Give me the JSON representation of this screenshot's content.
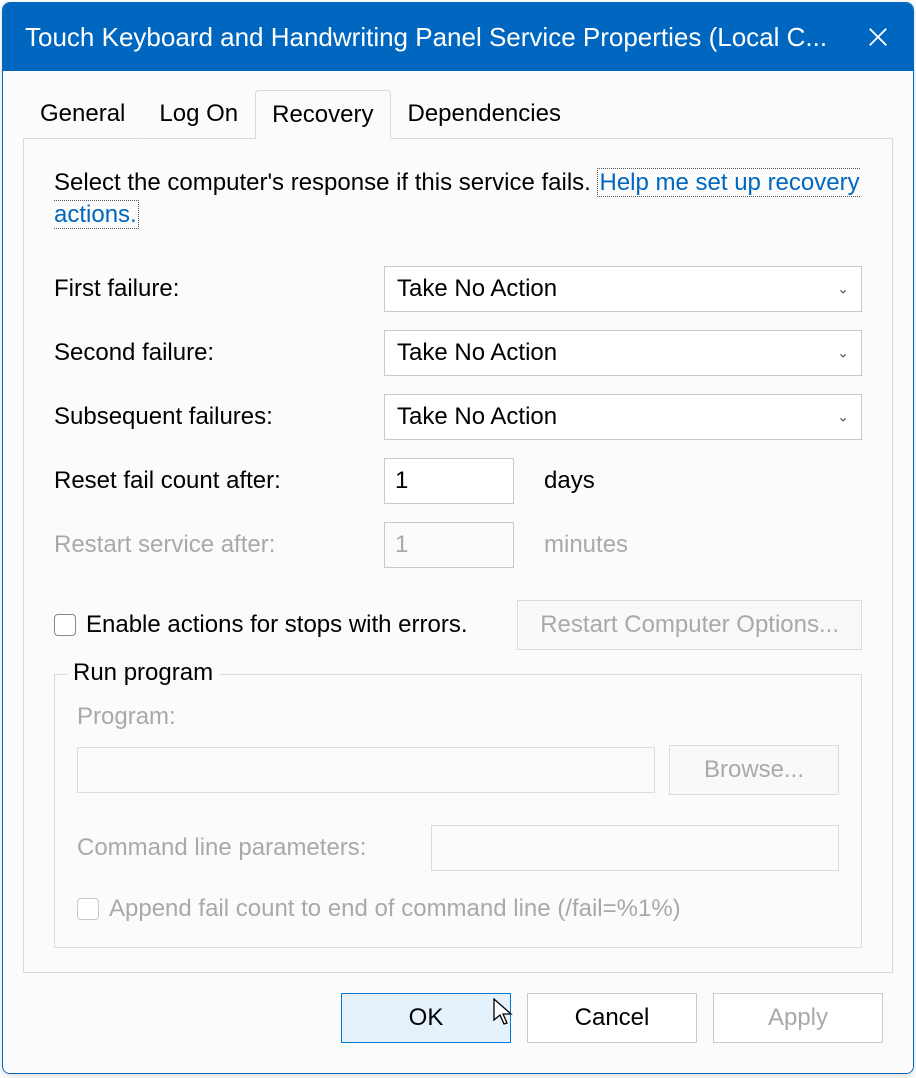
{
  "titlebar": {
    "title": "Touch Keyboard and Handwriting Panel Service Properties (Local C..."
  },
  "tabs": {
    "general": "General",
    "logon": "Log On",
    "recovery": "Recovery",
    "dependencies": "Dependencies"
  },
  "intro": {
    "text": "Select the computer's response if this service fails.",
    "link": "Help me set up recovery actions."
  },
  "rows": {
    "first": {
      "label": "First failure:",
      "value": "Take No Action"
    },
    "second": {
      "label": "Second failure:",
      "value": "Take No Action"
    },
    "subsequent": {
      "label": "Subsequent failures:",
      "value": "Take No Action"
    },
    "reset": {
      "label": "Reset fail count after:",
      "value": "1",
      "unit": "days"
    },
    "restart": {
      "label": "Restart service after:",
      "value": "1",
      "unit": "minutes"
    }
  },
  "enable_stops": {
    "label": "Enable actions for stops with errors."
  },
  "rco_button": "Restart Computer Options...",
  "runprog": {
    "legend": "Run program",
    "program_label": "Program:",
    "browse": "Browse...",
    "cmdparams_label": "Command line parameters:",
    "append_label": "Append fail count to end of command line (/fail=%1%)"
  },
  "footer": {
    "ok": "OK",
    "cancel": "Cancel",
    "apply": "Apply"
  }
}
